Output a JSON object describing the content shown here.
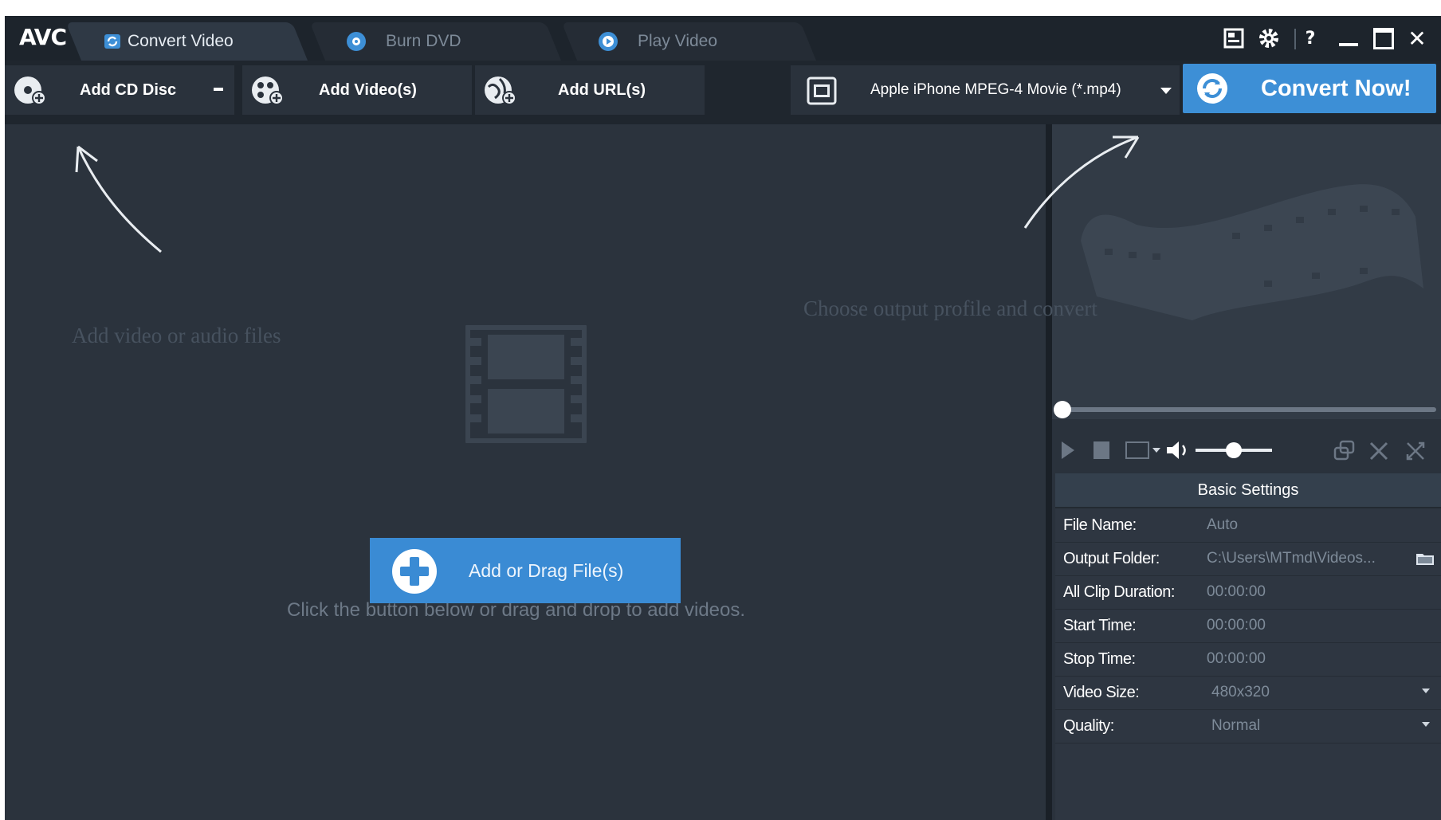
{
  "app": {
    "logo": "AVC"
  },
  "tabs": [
    {
      "label": "Convert Video",
      "icon": "convert-icon",
      "active": true
    },
    {
      "label": "Burn DVD",
      "icon": "disc-icon",
      "active": false
    },
    {
      "label": "Play Video",
      "icon": "play-icon",
      "active": false
    }
  ],
  "window_controls": [
    {
      "name": "skin-icon"
    },
    {
      "name": "settings-gear-icon"
    },
    {
      "name": "help-icon",
      "glyph": "?"
    },
    {
      "name": "minimize-icon",
      "glyph": "_"
    },
    {
      "name": "maximize-icon",
      "glyph": "□"
    },
    {
      "name": "close-icon",
      "glyph": "✕"
    }
  ],
  "toolbar": {
    "add_cd": "Add CD Disc",
    "add_videos": "Add Video(s)",
    "add_url": "Add URL(s)",
    "profile": "Apple iPhone MPEG-4 Movie (*.mp4)",
    "convert": "Convert Now!"
  },
  "main": {
    "hint_left": "Add video or audio files",
    "hint_right": "Choose output profile and convert",
    "drop_message": "Click the button below or drag and drop to add videos.",
    "add_button": "Add or Drag File(s)"
  },
  "player": {
    "seek_position": 0.0,
    "volume_level": 0.5
  },
  "settings": {
    "title": "Basic Settings",
    "rows": [
      {
        "key": "File Name:",
        "value": "Auto"
      },
      {
        "key": "Output Folder:",
        "value": "C:\\Users\\MTmd\\Videos..."
      },
      {
        "key": "All Clip Duration:",
        "value": "00:00:00"
      },
      {
        "key": "Start Time:",
        "value": "00:00:00"
      },
      {
        "key": "Stop Time:",
        "value": "00:00:00"
      },
      {
        "key": "Video Size:",
        "value": "480x320"
      },
      {
        "key": "Quality:",
        "value": "Normal"
      }
    ]
  },
  "colors": {
    "accent": "#3d8fd6",
    "background": "#2b333d",
    "titlebar": "#1d242c"
  }
}
